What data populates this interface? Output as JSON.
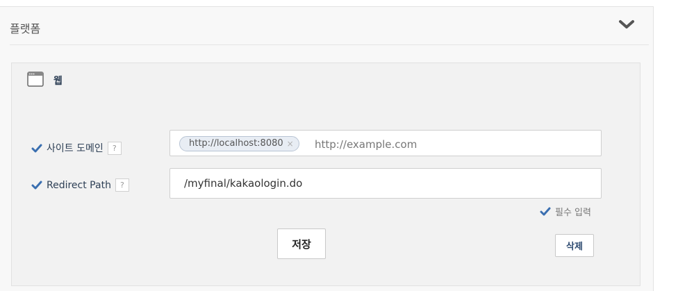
{
  "panel": {
    "title": "플랫폼",
    "collapse_icon": "chevron-down-icon"
  },
  "web": {
    "icon": "browser-window-icon",
    "title": "웹",
    "site_domain": {
      "label": "사이트 도메인",
      "help": "?",
      "tag": "http://localhost:8080",
      "tag_remove": "×",
      "placeholder": "http://example.com"
    },
    "redirect_path": {
      "label": "Redirect Path",
      "help": "?",
      "value": "/myfinal/kakaologin.do"
    },
    "required_note": "필수 입력",
    "save_label": "저장",
    "delete_label": "삭제"
  },
  "colors": {
    "accent": "#3a6fb0",
    "label_text": "#2d3f55",
    "panel_bg": "#f8f8f8",
    "box_bg": "#f2f2f2"
  }
}
